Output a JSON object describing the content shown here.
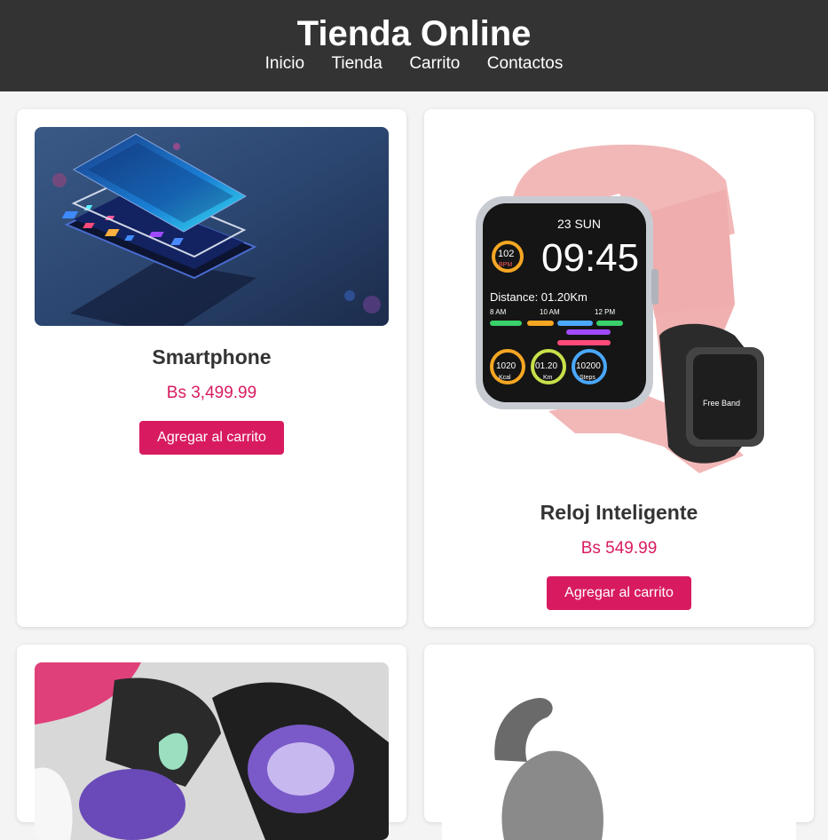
{
  "header": {
    "title": "Tienda Online",
    "nav": [
      "Inicio",
      "Tienda",
      "Carrito",
      "Contactos"
    ]
  },
  "products": [
    {
      "name": "Smartphone",
      "price": "Bs 3,499.99",
      "button": "Agregar al carrito"
    },
    {
      "name": "Reloj Inteligente",
      "price": "Bs 549.99",
      "button": "Agregar al carrito",
      "watch_screen": {
        "date": "23 SUN",
        "time": "09:45",
        "bpm": "102",
        "bpm_label": "BPM",
        "distance": "Distance: 01.20Km",
        "hours": [
          "8 AM",
          "10 AM",
          "12 PM"
        ],
        "gauges": [
          {
            "value": "1020",
            "label": "Kcal"
          },
          {
            "value": "01.20",
            "label": "Km"
          },
          {
            "value": "10200",
            "label": "Steps"
          }
        ],
        "band_label": "Free Band"
      }
    }
  ],
  "colors": {
    "header_bg": "#333333",
    "accent": "#d81b60",
    "page_bg": "#f4f4f4"
  }
}
